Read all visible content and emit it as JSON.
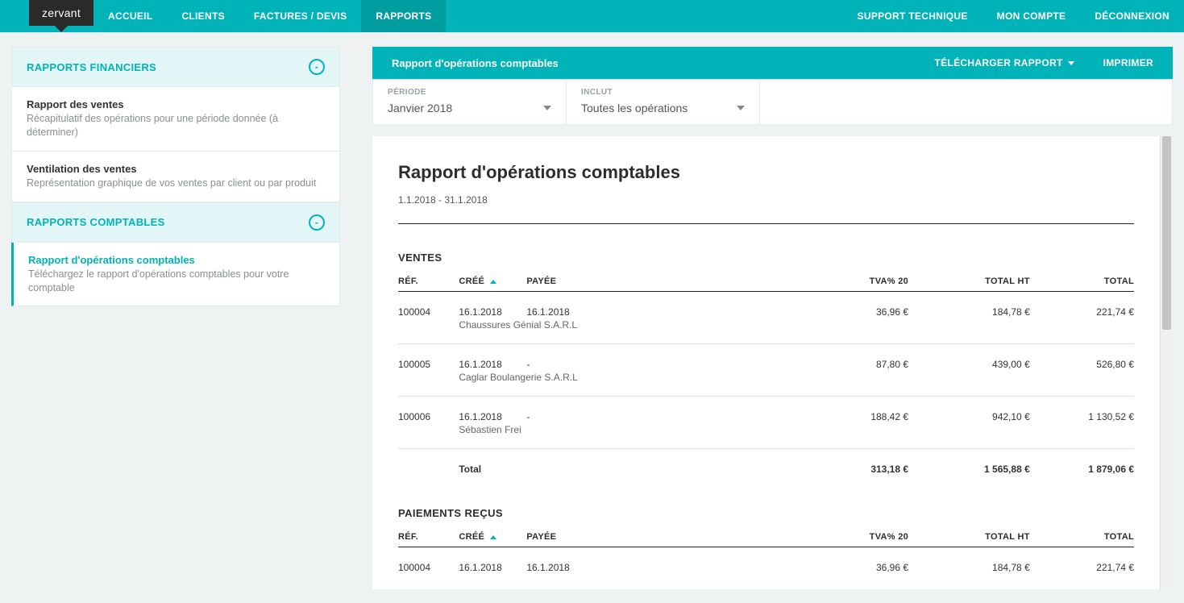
{
  "brand": "zervant",
  "nav": {
    "left": [
      {
        "label": "ACCUEIL"
      },
      {
        "label": "CLIENTS"
      },
      {
        "label": "FACTURES / DEVIS"
      },
      {
        "label": "RAPPORTS",
        "active": true
      }
    ],
    "right": [
      {
        "label": "SUPPORT TECHNIQUE"
      },
      {
        "label": "MON COMPTE"
      },
      {
        "label": "DÉCONNEXION"
      }
    ]
  },
  "sidebar": {
    "group1": {
      "heading": "RAPPORTS FINANCIERS",
      "items": [
        {
          "title": "Rapport des ventes",
          "desc": "Récapitulatif des opérations pour une période donnée (à déterminer)"
        },
        {
          "title": "Ventilation des ventes",
          "desc": "Représentation graphique de vos ventes par client ou par produit"
        }
      ]
    },
    "group2": {
      "heading": "RAPPORTS COMPTABLES",
      "items": [
        {
          "title": "Rapport d'opérations comptables",
          "desc": "Téléchargez le rapport d'opérations comptables pour votre comptable"
        }
      ]
    }
  },
  "toolbar": {
    "title": "Rapport d'opérations comptables",
    "download": "TÉLÉCHARGER RAPPORT",
    "print": "IMPRIMER"
  },
  "filters": {
    "period_label": "PÉRIODE",
    "period_value": "Janvier 2018",
    "include_label": "INCLUT",
    "include_value": "Toutes les opérations"
  },
  "report": {
    "title": "Rapport d'opérations comptables",
    "date_range": "1.1.2018 - 31.1.2018",
    "sales_heading": "VENTES",
    "payments_heading": "PAIEMENTS REÇUS",
    "cols": {
      "ref": "RÉF.",
      "cree": "CRÉÉ",
      "payee": "PAYÉE",
      "tva": "TVA% 20",
      "ht": "TOTAL HT",
      "total": "TOTAL"
    },
    "sales": [
      {
        "ref": "100004",
        "cree": "16.1.2018",
        "payee": "16.1.2018",
        "client": "Chaussures Génial S.A.R.L",
        "tva": "36,96 €",
        "ht": "184,78 €",
        "total": "221,74 €"
      },
      {
        "ref": "100005",
        "cree": "16.1.2018",
        "payee": "-",
        "client": "Caglar Boulangerie S.A.R.L",
        "tva": "87,80 €",
        "ht": "439,00 €",
        "total": "526,80 €"
      },
      {
        "ref": "100006",
        "cree": "16.1.2018",
        "payee": "-",
        "client": "Sébastien Frei",
        "tva": "188,42 €",
        "ht": "942,10 €",
        "total": "1 130,52 €"
      }
    ],
    "sales_total": {
      "label": "Total",
      "tva": "313,18 €",
      "ht": "1 565,88 €",
      "total": "1 879,06 €"
    },
    "payments": [
      {
        "ref": "100004",
        "cree": "16.1.2018",
        "payee": "16.1.2018",
        "tva": "36,96 €",
        "ht": "184,78 €",
        "total": "221,74 €"
      }
    ]
  }
}
